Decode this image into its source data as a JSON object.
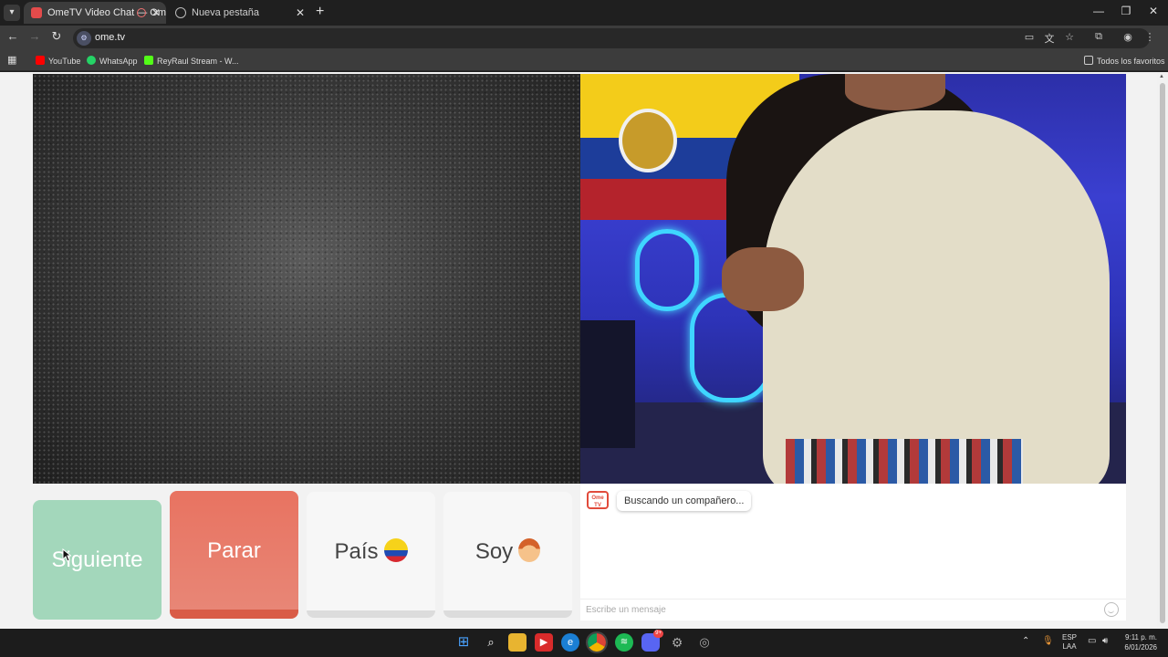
{
  "browser": {
    "tabs": [
      {
        "title": "OmeTV Video Chat — Ome",
        "active": true
      },
      {
        "title": "Nueva pestaña",
        "active": false
      }
    ],
    "url": "ome.tv",
    "bookmarks": [
      {
        "label": "YouTube",
        "icon": "youtube-icon",
        "color": "#ff0000"
      },
      {
        "label": "WhatsApp",
        "icon": "whatsapp-icon",
        "color": "#25d366"
      },
      {
        "label": "ReyRaul Stream - W...",
        "icon": "kick-icon",
        "color": "#53fc18"
      }
    ],
    "all_bookmarks_label": "Todos los favoritos",
    "window_controls": {
      "minimize": "—",
      "restore": "❐",
      "close": "✕"
    }
  },
  "page": {
    "buttons": {
      "next": "Siguiente",
      "stop": "Parar",
      "country": "País",
      "gender": "Soy"
    },
    "chat": {
      "logo_text": "Ome TV",
      "status_message": "Buscando un compañero...",
      "input_placeholder": "Escribe un mensaje"
    },
    "colors": {
      "next_button": "#a3d7bb",
      "stop_button": "#e87361",
      "chat_logo": "#e14b3b"
    }
  },
  "taskbar": {
    "lang_top": "ESP",
    "lang_bottom": "LAA",
    "time": "9:11 p. m.",
    "date": "6/01/2026",
    "discord_badge": "9+"
  }
}
